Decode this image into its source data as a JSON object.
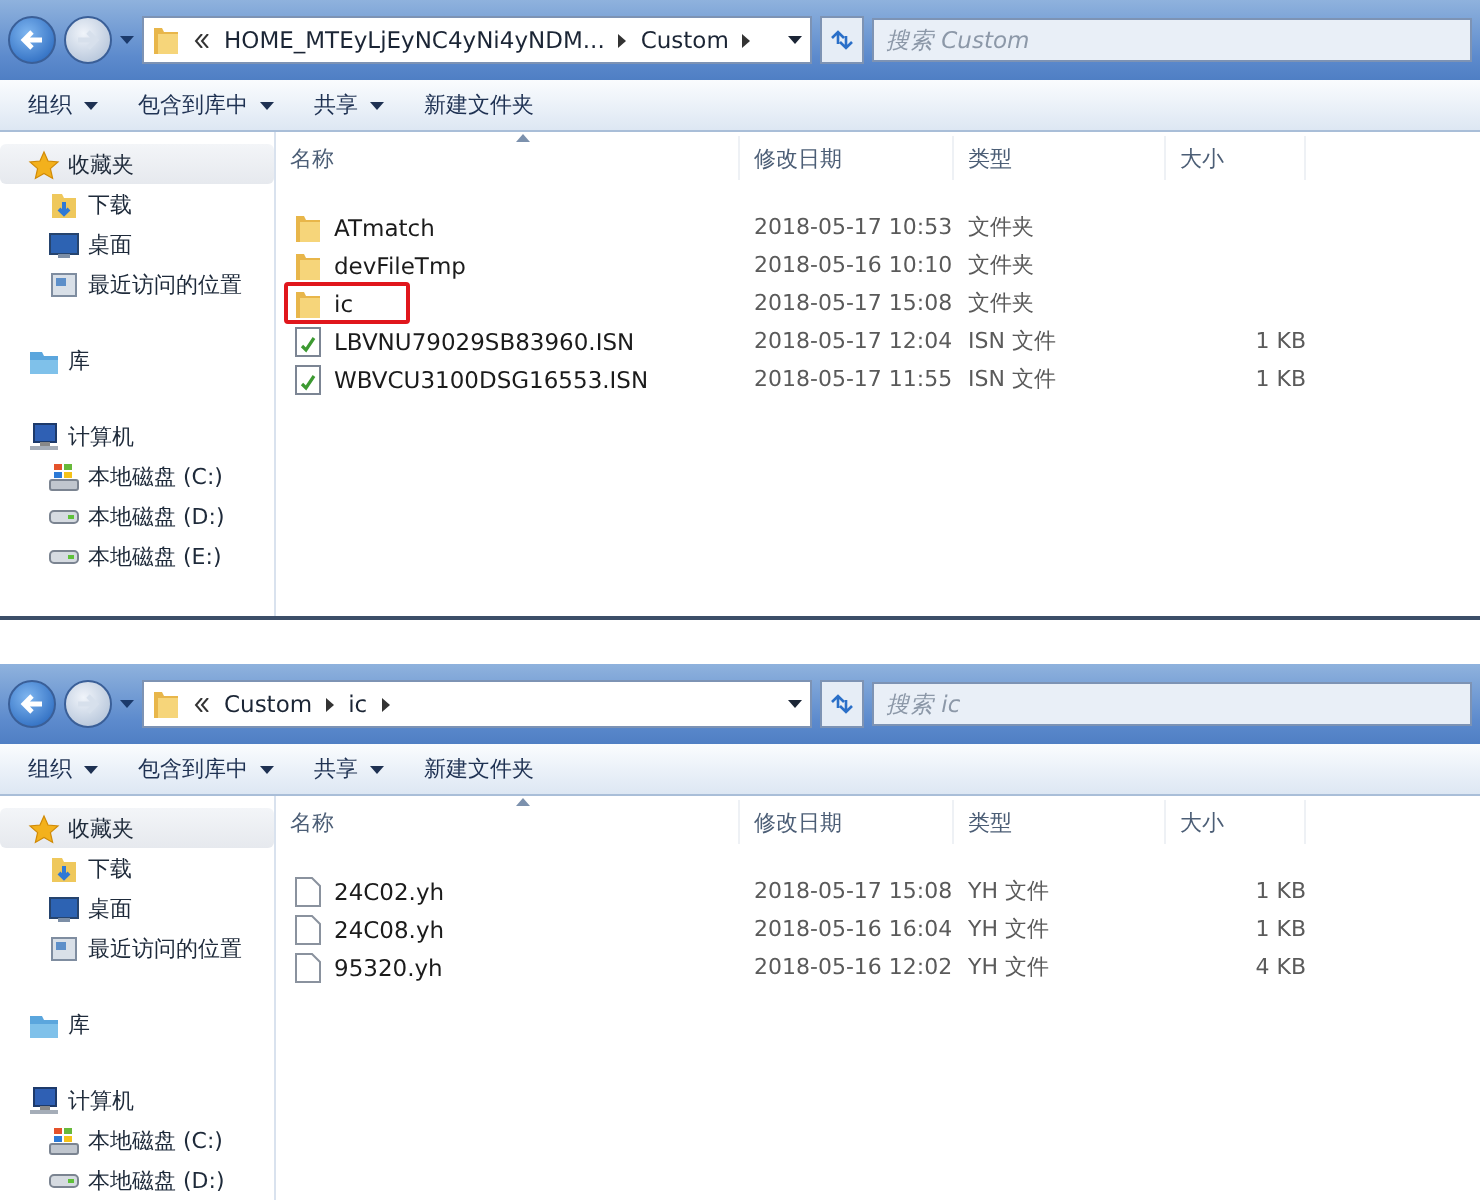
{
  "windows": [
    {
      "address": {
        "crumbs": [
          "HOME_MTEyLjEyNC4yNi4yNDM...",
          "Custom"
        ],
        "overflow": true
      },
      "search": {
        "placeholder": "搜索 Custom"
      },
      "toolbar": [
        {
          "label": "组织",
          "has_menu": true
        },
        {
          "label": "包含到库中",
          "has_menu": true
        },
        {
          "label": "共享",
          "has_menu": true
        },
        {
          "label": "新建文件夹",
          "has_menu": false
        }
      ],
      "sidebar": [
        {
          "label": "收藏夹",
          "kind": "star",
          "selected": true,
          "children": [
            {
              "label": "下载",
              "kind": "download"
            },
            {
              "label": "桌面",
              "kind": "desktop"
            },
            {
              "label": "最近访问的位置",
              "kind": "recent"
            }
          ]
        },
        {
          "label": "库",
          "kind": "library",
          "selected": false
        },
        {
          "label": "计算机",
          "kind": "computer",
          "selected": false,
          "children": [
            {
              "label": "本地磁盘 (C:)",
              "kind": "system"
            },
            {
              "label": "本地磁盘 (D:)",
              "kind": "drive"
            },
            {
              "label": "本地磁盘 (E:)",
              "kind": "drive"
            }
          ]
        }
      ],
      "columns": [
        {
          "label": "名称",
          "sorted": true
        },
        {
          "label": "修改日期",
          "sorted": false
        },
        {
          "label": "类型",
          "sorted": false
        },
        {
          "label": "大小",
          "sorted": false
        }
      ],
      "rows": [
        {
          "kind": "folder",
          "name": "ATmatch",
          "date": "2018-05-17 10:53",
          "type": "文件夹",
          "highlighted": false
        },
        {
          "kind": "folder",
          "name": "devFileTmp",
          "date": "2018-05-16 10:10",
          "type": "文件夹",
          "highlighted": false
        },
        {
          "kind": "folder",
          "name": "ic",
          "date": "2018-05-17 15:08",
          "type": "文件夹",
          "highlighted": true
        },
        {
          "kind": "data",
          "name": "LBVNU79029SB83960.ISN",
          "date": "2018-05-17 12:04",
          "type": "ISN 文件",
          "size": "1 KB",
          "highlighted": false
        },
        {
          "kind": "data",
          "name": "WBVCU3100DSG16553.ISN",
          "date": "2018-05-17 11:55",
          "type": "ISN 文件",
          "size": "1 KB",
          "highlighted": false
        }
      ]
    },
    {
      "address": {
        "crumbs": [
          "Custom",
          "ic"
        ],
        "overflow": true
      },
      "search": {
        "placeholder": "搜索 ic"
      },
      "toolbar": [
        {
          "label": "组织",
          "has_menu": true
        },
        {
          "label": "包含到库中",
          "has_menu": true
        },
        {
          "label": "共享",
          "has_menu": true
        },
        {
          "label": "新建文件夹",
          "has_menu": false
        }
      ],
      "sidebar": [
        {
          "label": "收藏夹",
          "kind": "star",
          "selected": true,
          "children": [
            {
              "label": "下载",
              "kind": "download"
            },
            {
              "label": "桌面",
              "kind": "desktop"
            },
            {
              "label": "最近访问的位置",
              "kind": "recent"
            }
          ]
        },
        {
          "label": "库",
          "kind": "library",
          "selected": false
        },
        {
          "label": "计算机",
          "kind": "computer",
          "selected": false,
          "children": [
            {
              "label": "本地磁盘 (C:)",
              "kind": "system"
            },
            {
              "label": "本地磁盘 (D:)",
              "kind": "drive"
            }
          ]
        }
      ],
      "columns": [
        {
          "label": "名称",
          "sorted": true
        },
        {
          "label": "修改日期",
          "sorted": false
        },
        {
          "label": "类型",
          "sorted": false
        },
        {
          "label": "大小",
          "sorted": false
        }
      ],
      "rows": [
        {
          "kind": "blank",
          "name": "24C02.yh",
          "date": "2018-05-17 15:08",
          "type": "YH 文件",
          "size": "1 KB",
          "highlighted": false
        },
        {
          "kind": "blank",
          "name": "24C08.yh",
          "date": "2018-05-16 16:04",
          "type": "YH 文件",
          "size": "1 KB",
          "highlighted": false
        },
        {
          "kind": "blank",
          "name": "95320.yh",
          "date": "2018-05-16 12:02",
          "type": "YH 文件",
          "size": "4 KB",
          "highlighted": false
        }
      ]
    }
  ]
}
